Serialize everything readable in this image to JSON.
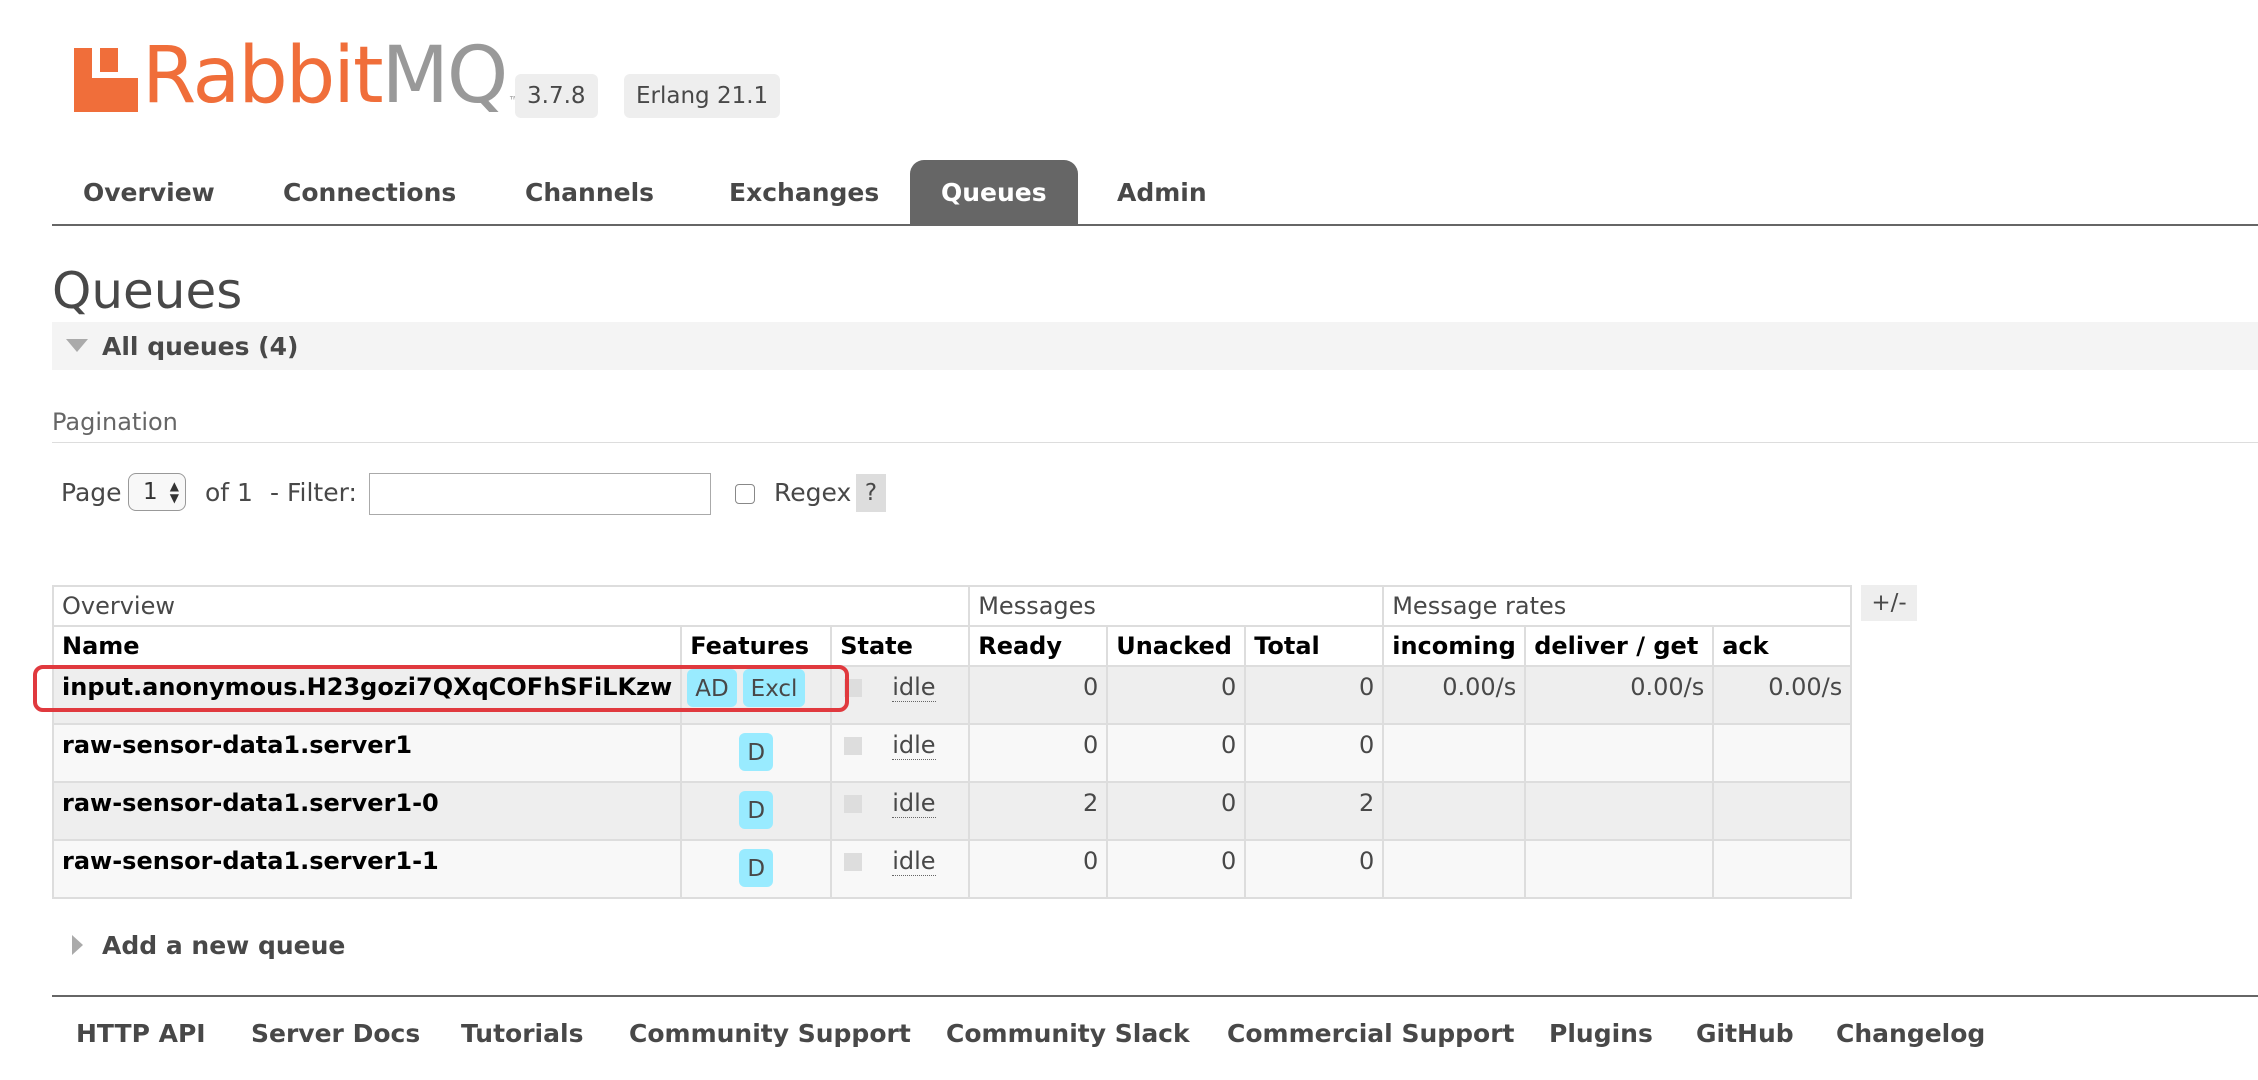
{
  "header": {
    "logo_text_rabbit": "Rabbit",
    "logo_text_mq": "MQ",
    "logo_tm": "™",
    "version": "3.7.8",
    "erlang": "Erlang 21.1"
  },
  "tabs": [
    {
      "label": "Overview"
    },
    {
      "label": "Connections"
    },
    {
      "label": "Channels"
    },
    {
      "label": "Exchanges"
    },
    {
      "label": "Queues",
      "active": true
    },
    {
      "label": "Admin"
    }
  ],
  "page": {
    "title": "Queues",
    "section_label": "All queues (4)",
    "pagination_label": "Pagination",
    "page_label": "Page",
    "page_value": "1",
    "of_label": "of 1",
    "filter_label": "- Filter:",
    "filter_value": "",
    "regex_label": "Regex",
    "help_label": "?",
    "toggle_columns": "+/-",
    "add_queue_label": "Add a new queue"
  },
  "table": {
    "groups": [
      "Overview",
      "Messages",
      "Message rates"
    ],
    "columns": [
      "Name",
      "Features",
      "State",
      "Ready",
      "Unacked",
      "Total",
      "incoming",
      "deliver / get",
      "ack"
    ],
    "rows": [
      {
        "name": "input.anonymous.H23gozi7QXqCOFhSFiLKzw",
        "features": [
          "AD",
          "Excl"
        ],
        "state": "idle",
        "ready": "0",
        "unacked": "0",
        "total": "0",
        "incoming": "0.00/s",
        "deliver": "0.00/s",
        "ack": "0.00/s"
      },
      {
        "name": "raw-sensor-data1.server1",
        "features": [
          "D"
        ],
        "state": "idle",
        "ready": "0",
        "unacked": "0",
        "total": "0",
        "incoming": "",
        "deliver": "",
        "ack": ""
      },
      {
        "name": "raw-sensor-data1.server1-0",
        "features": [
          "D"
        ],
        "state": "idle",
        "ready": "2",
        "unacked": "0",
        "total": "2",
        "incoming": "",
        "deliver": "",
        "ack": ""
      },
      {
        "name": "raw-sensor-data1.server1-1",
        "features": [
          "D"
        ],
        "state": "idle",
        "ready": "0",
        "unacked": "0",
        "total": "0",
        "incoming": "",
        "deliver": "",
        "ack": ""
      }
    ]
  },
  "footer": {
    "links": [
      "HTTP API",
      "Server Docs",
      "Tutorials",
      "Community Support",
      "Community Slack",
      "Commercial Support",
      "Plugins",
      "GitHub",
      "Changelog"
    ]
  },
  "colors": {
    "brand": "#f06e3a",
    "active_tab": "#666666",
    "feature_chip": "#99ebff",
    "highlight": "#e0393e"
  }
}
